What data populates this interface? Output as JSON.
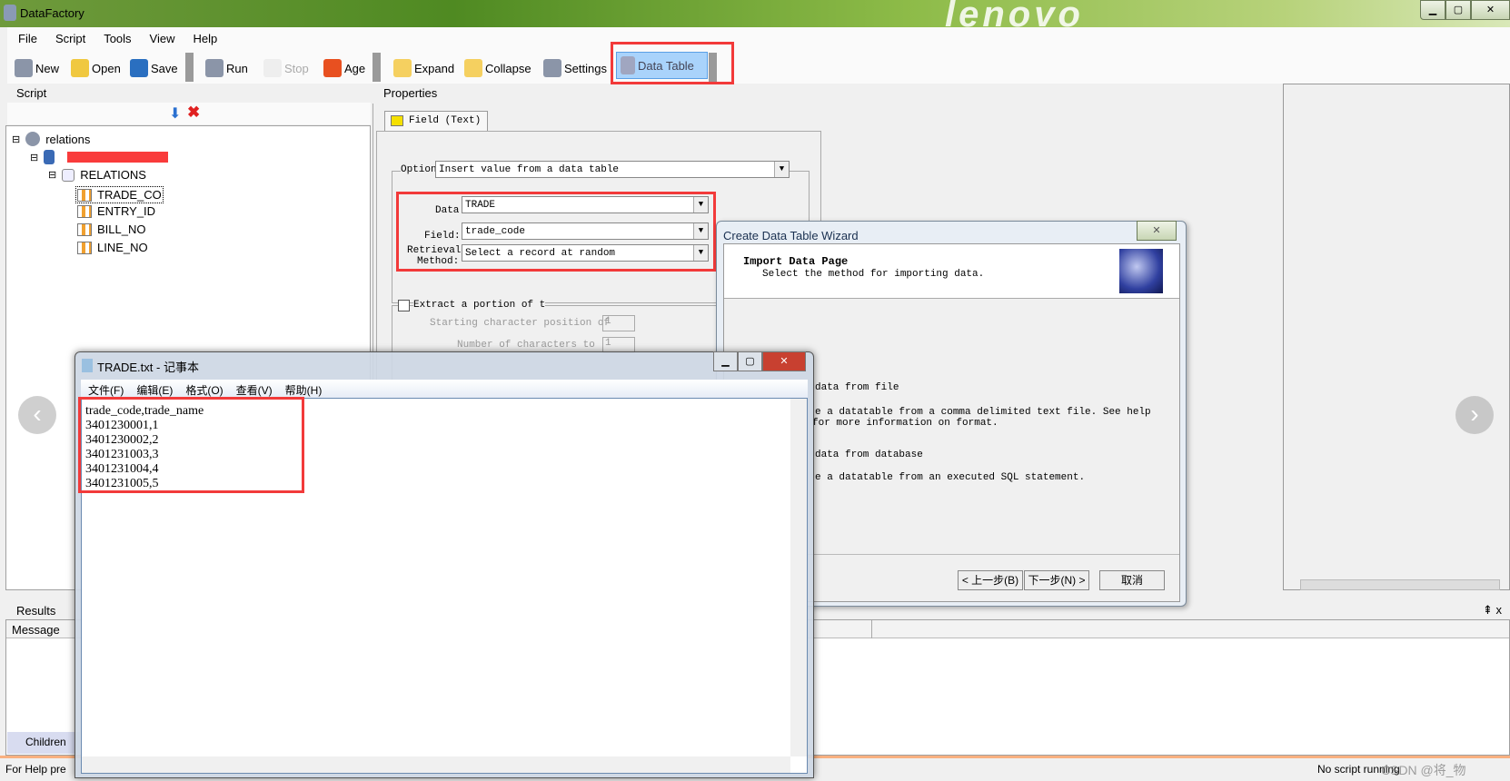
{
  "app": {
    "title": "DataFactory",
    "watermark_logo": "lenovo"
  },
  "menu": [
    "File",
    "Script",
    "Tools",
    "View",
    "Help"
  ],
  "toolbar": {
    "new": "New",
    "open": "Open",
    "save": "Save",
    "run": "Run",
    "stop": "Stop",
    "age": "Age",
    "expand": "Expand",
    "collapse": "Collapse",
    "settings": "Settings",
    "data_table": "Data Table"
  },
  "script_panel": {
    "title": "Script",
    "tree": {
      "root": "relations",
      "table": "RELATIONS",
      "fields": [
        "TRADE_CO",
        "ENTRY_ID",
        "BILL_NO",
        "LINE_NO"
      ]
    }
  },
  "properties": {
    "title": "Properties",
    "tab": "Field (Text)",
    "option_label": "Option",
    "option_value": "Insert value from a data table",
    "data_label": "Data",
    "data_value": "TRADE",
    "field_label": "Field:",
    "field_value": "trade_code",
    "retrieval_label_1": "Retrieval",
    "retrieval_label_2": "Method:",
    "retrieval_value": "Select a record at random",
    "extract_label": "Extract a portion of t",
    "start_label": "Starting character position of",
    "start_value": "1",
    "count_label": "Number of characters to",
    "count_value": "1"
  },
  "wizard": {
    "title": "Create Data Table Wizard",
    "page_title": "Import Data Page",
    "page_subtitle": "Select the method for importing data.",
    "opt1_title": "data from file",
    "opt1_desc1": "e a datatable from a comma delimited text file.  See help",
    "opt1_desc2": "for more information on format.",
    "opt2_title": "data from database",
    "opt2_desc": "e a datatable from an executed SQL statement.",
    "back": "< 上一步(B)",
    "next": "下一步(N) >",
    "cancel": "取消"
  },
  "notepad": {
    "title": "TRADE.txt - 记事本",
    "menu": [
      "文件(F)",
      "编辑(E)",
      "格式(O)",
      "查看(V)",
      "帮助(H)"
    ],
    "lines": [
      "trade_code,trade_name",
      "3401230001,1",
      "3401230002,2",
      "3401231003,3",
      "3401231004,4",
      "3401231005,5"
    ]
  },
  "results": {
    "title": "Results",
    "col_message": "Message",
    "pin": "⇞ x"
  },
  "bottom": {
    "children_tab": "Children",
    "status_left": "For Help pre",
    "status_right": "No script running",
    "watermark": "CSDN @将_物"
  },
  "colors": {
    "highlight": "#f23a3a",
    "selected_button": "#a9d3fb",
    "title_green": "#5f9a2a"
  }
}
